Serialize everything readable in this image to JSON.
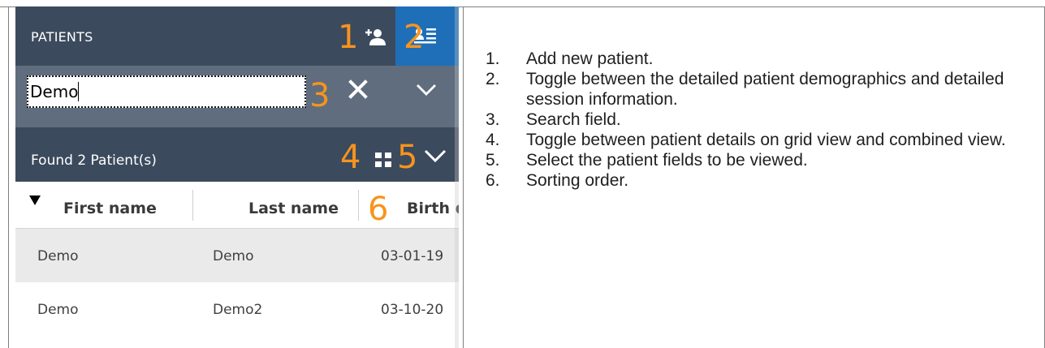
{
  "header": {
    "title": "PATIENTS",
    "add_user_icon": "add-user-icon",
    "toggle_icon": "demographics-list-icon"
  },
  "annotations": [
    "1",
    "2",
    "3",
    "4",
    "5",
    "6"
  ],
  "search": {
    "value": "Demo",
    "clear_icon": "close-icon",
    "dropdown_icon": "chevron-down-icon"
  },
  "results": {
    "found_text": "Found 2 Patient(s)",
    "grid_icon": "grid-icon",
    "fields_icon": "chevron-down-icon"
  },
  "table": {
    "sort_indicator": "sort-desc-arrow-icon",
    "columns": [
      "First name",
      "Last name",
      "Birth d"
    ],
    "rows": [
      {
        "first": "Demo",
        "last": "Demo",
        "birth": "03-01-19"
      },
      {
        "first": "Demo",
        "last": "Demo2",
        "birth": "03-10-20"
      }
    ]
  },
  "descriptions": [
    {
      "num": "1.",
      "text": "Add new patient."
    },
    {
      "num": "2.",
      "text": "Toggle between the detailed patient demographics and detailed session information."
    },
    {
      "num": "3.",
      "text": "Search field."
    },
    {
      "num": "4.",
      "text": "Toggle between patient details on grid view and combined view."
    },
    {
      "num": "5.",
      "text": "Select the patient fields to be viewed."
    },
    {
      "num": "6.",
      "text": "Sorting order."
    }
  ],
  "colors": {
    "header_bg": "#3c4a5d",
    "search_bg": "#5f6d7f",
    "active_toggle": "#1e6fb8",
    "annotation": "#f7941d"
  }
}
